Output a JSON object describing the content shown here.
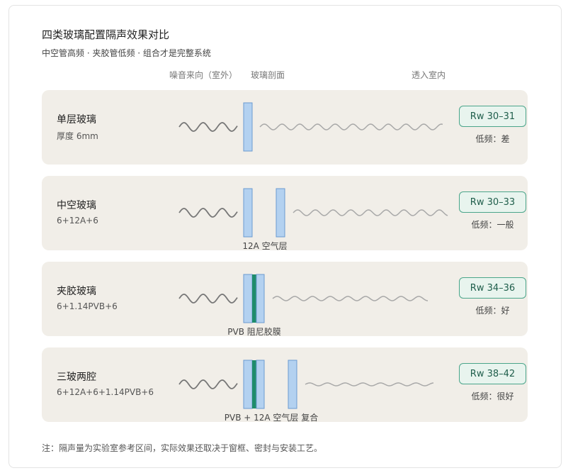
{
  "title": "四类玻璃配置隔声效果对比",
  "subtitle": "中空管高频 · 夹胶管低频 · 组合才是完整系统",
  "headers": {
    "source": "噪音来向（室外）",
    "section": "玻璃剖面",
    "indoor": "透入室内"
  },
  "colors": {
    "row_bg": "#f1eee8",
    "glass_fill": "#b3d1f0",
    "glass_stroke": "#6b9bd1",
    "pvb": "#1e8c6c",
    "incoming_wave": "#777777",
    "transmitted_wave": "#a8a8a8",
    "badge_border": "#4aa58a",
    "badge_bg": "#e8f4ee"
  },
  "rows": [
    {
      "name": "单层玻璃",
      "spec": "厚度 6mm",
      "rw": "Rw 30–31",
      "low_freq": "低频：差",
      "layer_note": ""
    },
    {
      "name": "中空玻璃",
      "spec": "6+12A+6",
      "rw": "Rw 30–33",
      "low_freq": "低频：一般",
      "layer_note": "12A 空气层"
    },
    {
      "name": "夹胶玻璃",
      "spec": "6+1.14PVB+6",
      "rw": "Rw 34–36",
      "low_freq": "低频：好",
      "layer_note": "PVB 阻尼胶膜"
    },
    {
      "name": "三玻两腔",
      "spec": "6+12A+6+1.14PVB+6",
      "rw": "Rw 38–42",
      "low_freq": "低频：很好",
      "layer_note": "PVB + 12A 空气层 复合"
    }
  ],
  "footnote": "注：隔声量为实验室参考区间，实际效果还取决于窗框、密封与安装工艺。"
}
